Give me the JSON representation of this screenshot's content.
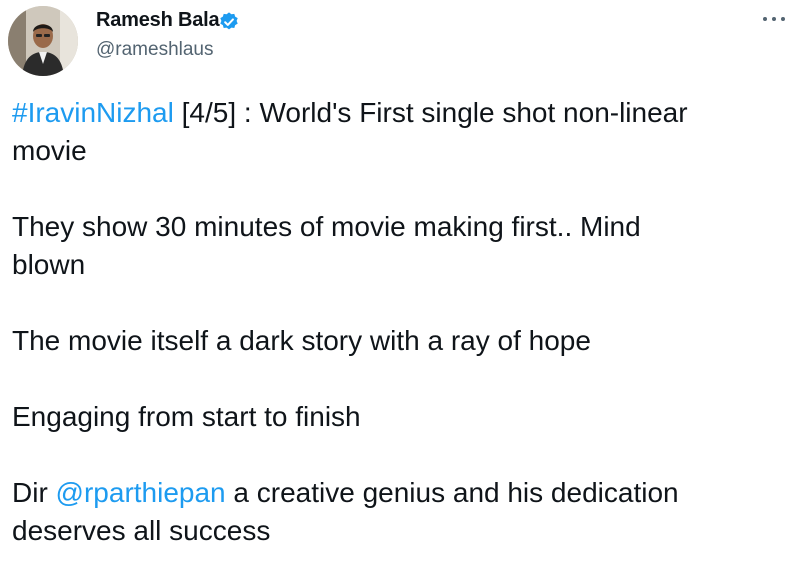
{
  "author": {
    "name": "Ramesh Bala",
    "handle": "@rameshlaus",
    "verified": true,
    "avatar_icon": "profile-photo-icon"
  },
  "menu_icon": "more-options-icon",
  "colors": {
    "link": "#1d9bf0",
    "verified": "#1d9bf0",
    "text": "#0f1419",
    "muted": "#536471"
  },
  "tweet": {
    "p1_hashtag": "#IravinNizhal",
    "p1_l1_rest": " [4/5] : World's First single shot non-linear",
    "p1_l2": "movie",
    "p2_l1": "They show 30 minutes of movie making first.. Mind",
    "p2_l2": "blown",
    "p3_l1": "The movie itself a dark story with a ray of hope",
    "p4_l1": "Engaging from start to finish",
    "p5_pre": "Dir ",
    "p5_mention": "@rparthiepan",
    "p5_l1_rest": " a creative genius and his dedication",
    "p5_l2": "deserves all success"
  }
}
